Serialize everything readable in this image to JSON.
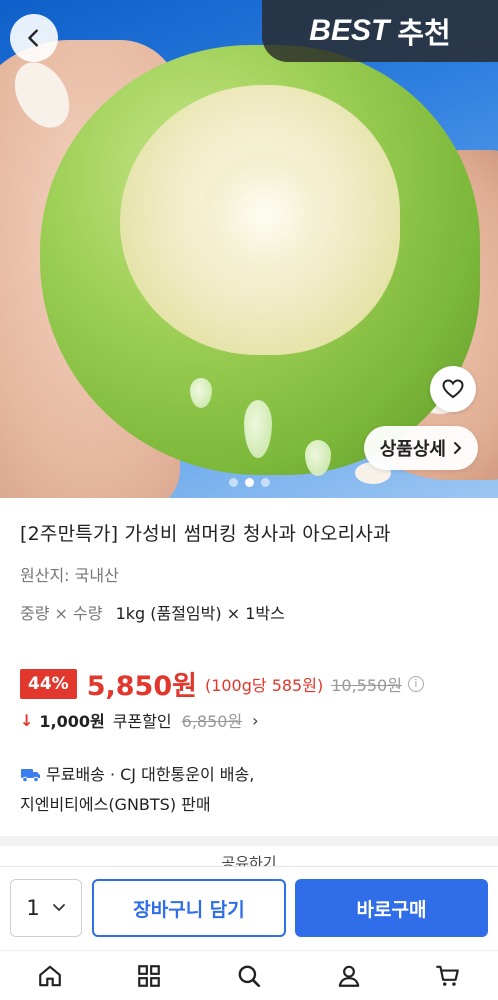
{
  "hero": {
    "badge_en": "BEST",
    "badge_ko": "추천",
    "detail_button": "상품상세",
    "carousel": {
      "count": 3,
      "active": 1
    }
  },
  "product": {
    "title": "[2주만특가] 가성비 썸머킹 청사과 아오리사과",
    "origin": "원산지: 국내산",
    "option_label": "중량 × 수량",
    "option_value": "1kg (품절임박) × 1박스"
  },
  "price": {
    "discount": "44%",
    "sale": "5,850원",
    "unit": "(100g당 585원)",
    "original": "10,550원"
  },
  "coupon": {
    "amount": "1,000원",
    "label": "쿠폰할인",
    "price": "6,850원"
  },
  "shipping": {
    "line1": "무료배송 · CJ 대한통운이 배송,",
    "line2": "지엔비티에스(GNBTS) 판매"
  },
  "share_peek": "공유하기",
  "buy_bar": {
    "quantity": "1",
    "cart_label": "장바구니 담기",
    "buy_label": "바로구매"
  },
  "colors": {
    "accent_blue": "#2f6ee8",
    "discount_red": "#e2372d"
  },
  "nav": [
    "home-icon",
    "category-grid-icon",
    "search-icon",
    "user-icon",
    "cart-icon"
  ]
}
